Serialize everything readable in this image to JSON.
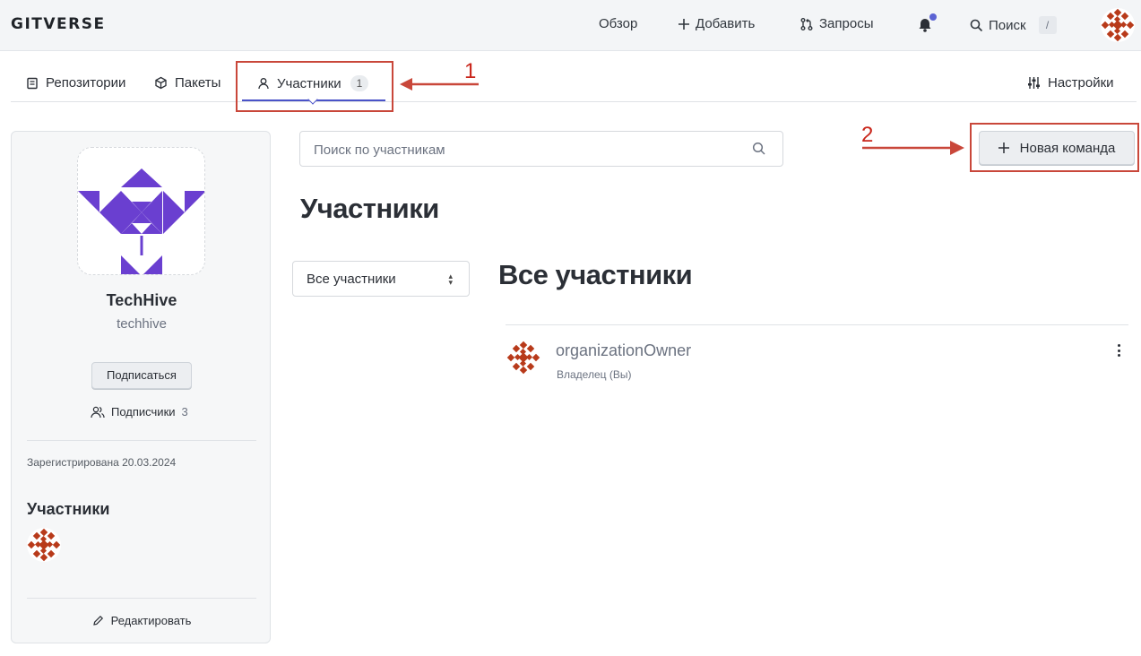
{
  "app": {
    "logo_text": "GITVERSE"
  },
  "topnav": {
    "overview": "Обзор",
    "add": "Добавить",
    "requests": "Запросы",
    "search": "Поиск",
    "search_shortcut": "/"
  },
  "tabs": [
    {
      "label": "Репозитории",
      "icon": "repo-icon"
    },
    {
      "label": "Пакеты",
      "icon": "package-icon"
    },
    {
      "label": "Участники",
      "icon": "person-icon",
      "count": "1",
      "active": true
    }
  ],
  "settings_label": "Настройки",
  "annotations": {
    "one": "1",
    "two": "2"
  },
  "sidebar": {
    "org_name": "TechHive",
    "org_slug": "techhive",
    "subscribe_label": "Подписаться",
    "followers_label": "Подписчики",
    "followers_count": "3",
    "registered": "Зарегистрирована 20.03.2024",
    "members_title": "Участники",
    "edit_label": "Редактировать"
  },
  "main": {
    "search_placeholder": "Поиск по участникам",
    "new_team_label": "Новая команда",
    "title": "Участники",
    "filter_value": "Все участники",
    "list_title": "Все участники",
    "members": [
      {
        "name": "organizationOwner",
        "role": "Владелец (Вы)"
      }
    ]
  },
  "colors": {
    "accent": "#4a53c8",
    "annotation": "#c9473a",
    "logo_purple": "#6a3fd0",
    "avatar_red": "#b83a1a"
  }
}
